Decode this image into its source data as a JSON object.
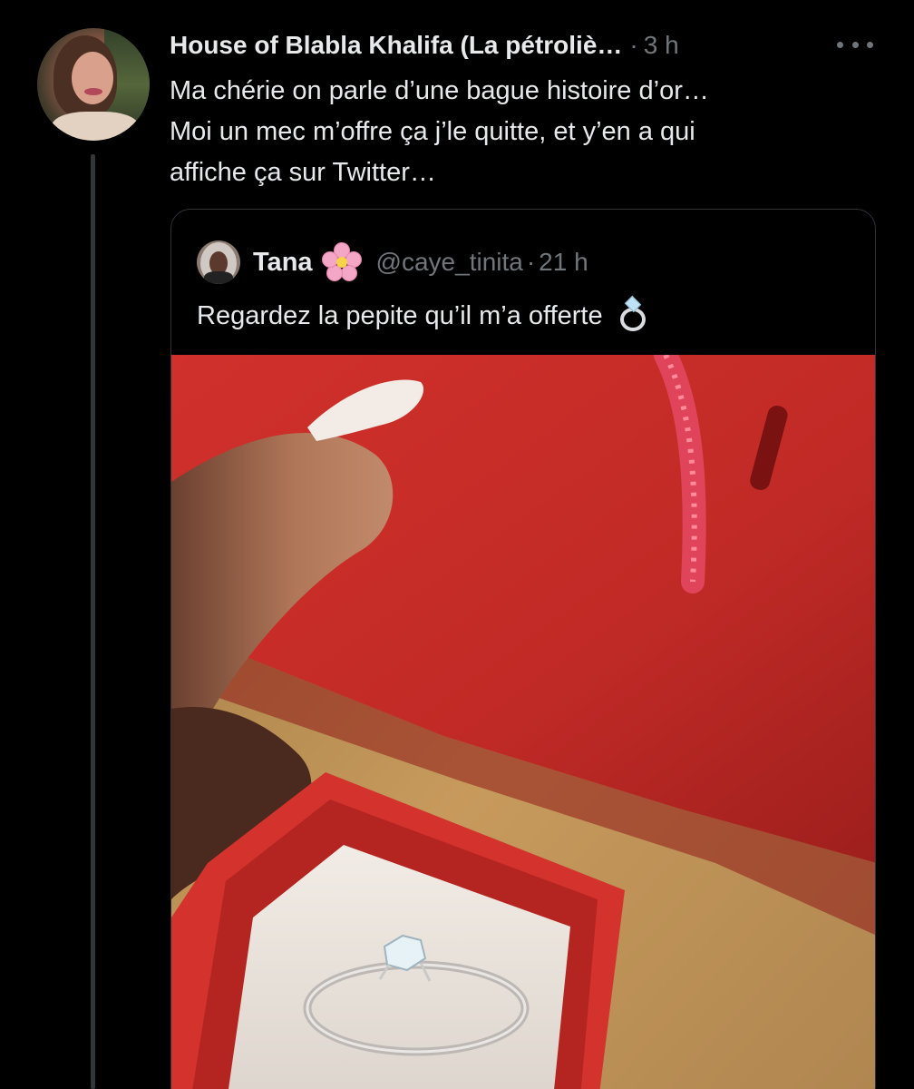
{
  "tweet": {
    "author_name": "House of Blabla Khalifa (La pétroliè…",
    "separator": "·",
    "time": "3 h",
    "text_lines": [
      "Ma chérie on parle d’une bague histoire d’or…",
      "Moi un mec m’offre ça j’le quitte, et y’en a qui",
      "affiche ça sur Twitter…"
    ],
    "icons": {
      "avatar": "profile-photo",
      "more": "more-options-icon"
    }
  },
  "quoted_tweet": {
    "name": "Tana",
    "name_emoji": "cherry-blossom-icon",
    "handle": "@caye_tinita",
    "separator": "·",
    "time": "21 h",
    "text": "Regardez la pepite qu’il m’a offerte",
    "text_emoji": "ring-icon",
    "image": "photo of a diamond solitaire ring in an open red box beside a red gift bag"
  },
  "colors": {
    "background": "#000000",
    "text_primary": "#e7e9ea",
    "text_secondary": "#71767b",
    "border": "#2f3336"
  }
}
